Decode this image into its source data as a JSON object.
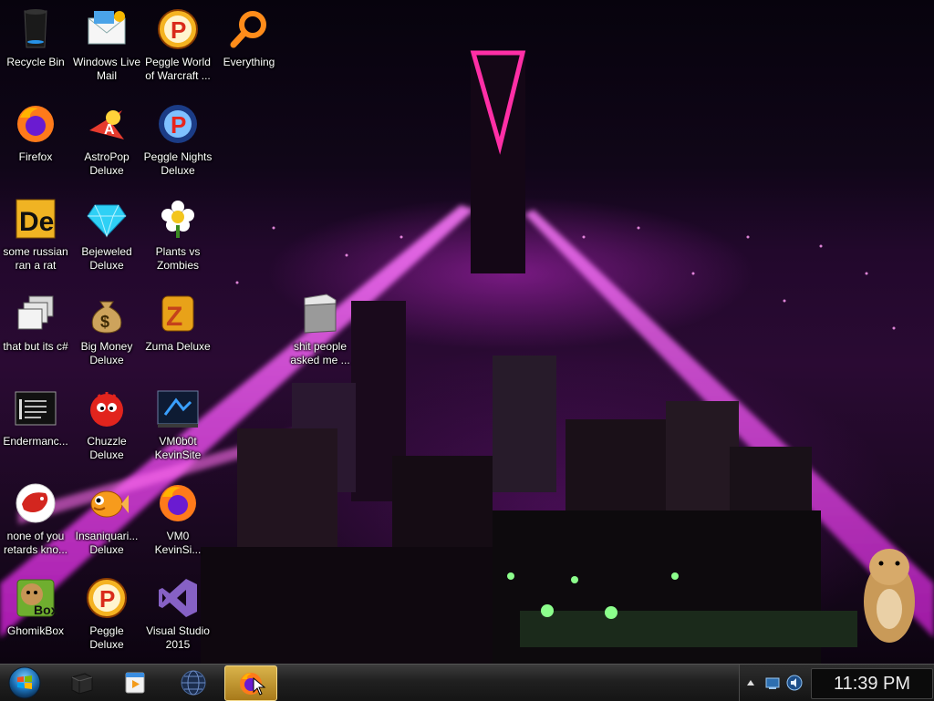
{
  "desktop": {
    "icons": [
      {
        "label": "Recycle Bin",
        "icon": "recycle-bin-icon"
      },
      {
        "label": "Windows Live Mail",
        "icon": "windows-live-mail-icon"
      },
      {
        "label": "Peggle World of Warcraft ...",
        "icon": "peggle-icon"
      },
      {
        "label": "Everything",
        "icon": "magnifier-icon"
      },
      {
        "label": "Firefox",
        "icon": "firefox-icon"
      },
      {
        "label": "AstroPop Deluxe",
        "icon": "astropop-icon"
      },
      {
        "label": "Peggle Nights Deluxe",
        "icon": "peggle-nights-icon"
      },
      {
        "label": "some russian ran a rat",
        "icon": "de-icon"
      },
      {
        "label": "Bejeweled Deluxe",
        "icon": "diamond-icon"
      },
      {
        "label": "Plants vs Zombies",
        "icon": "flower-icon"
      },
      {
        "label": "that but its c#",
        "icon": "stacked-windows-icon"
      },
      {
        "label": "Big Money Deluxe",
        "icon": "money-bag-icon"
      },
      {
        "label": "Zuma Deluxe",
        "icon": "zuma-icon"
      },
      {
        "label": "shit people asked me ...",
        "icon": "folder-icon"
      },
      {
        "label": "Endermanc...",
        "icon": "console-icon"
      },
      {
        "label": "Chuzzle Deluxe",
        "icon": "chuzzle-icon"
      },
      {
        "label": "VM0b0t KevinSite",
        "icon": "vm-icon"
      },
      {
        "label": "none of you retards kno...",
        "icon": "rat-logo-icon"
      },
      {
        "label": "Insaniquari... Deluxe",
        "icon": "fish-icon"
      },
      {
        "label": "VM0 KevinSi...",
        "icon": "firefox-icon"
      },
      {
        "label": "GhomikBox",
        "icon": "gopher-box-icon"
      },
      {
        "label": "Peggle Deluxe",
        "icon": "peggle-icon"
      },
      {
        "label": "Visual Studio 2015",
        "icon": "visual-studio-icon"
      }
    ]
  },
  "taskbar": {
    "start": "windows-orb-icon",
    "pinned": [
      {
        "icon": "terminal-box-icon",
        "active": false
      },
      {
        "icon": "media-player-icon",
        "active": false
      },
      {
        "icon": "globe-icon",
        "active": false
      },
      {
        "icon": "firefox-icon",
        "active": true
      }
    ],
    "tray": {
      "icons": [
        "show-hidden-icons-arrow-icon",
        "network-icon",
        "volume-icon"
      ],
      "clock": "11:39 PM"
    }
  },
  "colors": {
    "wallpaper_accent": "#c824d8",
    "taskbar": "#1e1e1e",
    "active_task": "#c99a32"
  }
}
